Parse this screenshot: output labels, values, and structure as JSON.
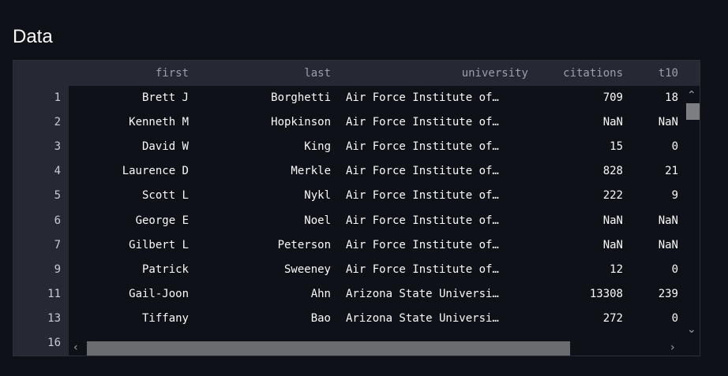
{
  "title": "Data",
  "table": {
    "columns": [
      "first",
      "last",
      "university",
      "citations",
      "t10"
    ],
    "rows": [
      {
        "index": "1",
        "first": "Brett J",
        "last": "Borghetti",
        "university": "Air Force Institute of…",
        "citations": "709",
        "t10": "18"
      },
      {
        "index": "2",
        "first": "Kenneth M",
        "last": "Hopkinson",
        "university": "Air Force Institute of…",
        "citations": "NaN",
        "t10": "NaN"
      },
      {
        "index": "3",
        "first": "David W",
        "last": "King",
        "university": "Air Force Institute of…",
        "citations": "15",
        "t10": "0"
      },
      {
        "index": "4",
        "first": "Laurence D",
        "last": "Merkle",
        "university": "Air Force Institute of…",
        "citations": "828",
        "t10": "21"
      },
      {
        "index": "5",
        "first": "Scott L",
        "last": "Nykl",
        "university": "Air Force Institute of…",
        "citations": "222",
        "t10": "9"
      },
      {
        "index": "6",
        "first": "George E",
        "last": "Noel",
        "university": "Air Force Institute of…",
        "citations": "NaN",
        "t10": "NaN"
      },
      {
        "index": "7",
        "first": "Gilbert L",
        "last": "Peterson",
        "university": "Air Force Institute of…",
        "citations": "NaN",
        "t10": "NaN"
      },
      {
        "index": "9",
        "first": "Patrick",
        "last": "Sweeney",
        "university": "Air Force Institute of…",
        "citations": "12",
        "t10": "0"
      },
      {
        "index": "11",
        "first": "Gail-Joon",
        "last": "Ahn",
        "university": "Arizona State Universi…",
        "citations": "13308",
        "t10": "239"
      },
      {
        "index": "13",
        "first": "Tiffany",
        "last": "Bao",
        "university": "Arizona State Universi…",
        "citations": "272",
        "t10": "0"
      },
      {
        "index": "16",
        "first": "",
        "last": "",
        "university": "",
        "citations": "",
        "t10": ""
      }
    ]
  },
  "icons": {
    "scroll_up": "chevron-up-icon",
    "scroll_down": "chevron-down-icon",
    "scroll_left": "chevron-left-icon",
    "scroll_right": "chevron-right-icon"
  },
  "colors": {
    "background": "#0e1117",
    "header_bg": "#262834",
    "text": "#fafafa",
    "header_text": "#9aa0ab"
  }
}
